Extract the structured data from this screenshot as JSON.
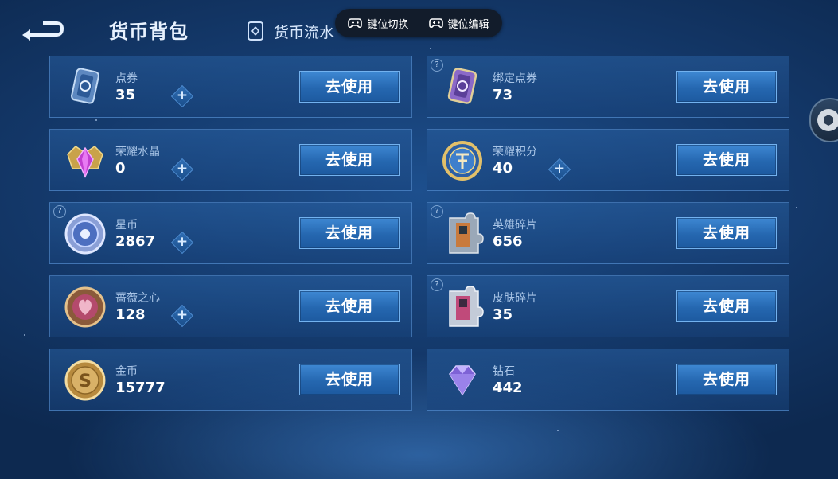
{
  "header": {
    "title": "货币背包",
    "flow_tab": "货币流水"
  },
  "overlay": {
    "switch_label": "键位切换",
    "edit_label": "键位编辑"
  },
  "items": [
    {
      "name": "点券",
      "amount": "35",
      "icon": "ticket-icon",
      "help": false,
      "plus": true,
      "button": "去使用"
    },
    {
      "name": "绑定点券",
      "amount": "73",
      "icon": "bound-ticket-icon",
      "help": true,
      "plus": false,
      "button": "去使用"
    },
    {
      "name": "荣耀水晶",
      "amount": "0",
      "icon": "glory-crystal-icon",
      "help": false,
      "plus": true,
      "button": "去使用"
    },
    {
      "name": "荣耀积分",
      "amount": "40",
      "icon": "glory-points-icon",
      "help": false,
      "plus": true,
      "button": "去使用"
    },
    {
      "name": "星币",
      "amount": "2867",
      "icon": "star-coin-icon",
      "help": true,
      "plus": true,
      "button": "去使用"
    },
    {
      "name": "英雄碎片",
      "amount": "656",
      "icon": "hero-fragment-icon",
      "help": true,
      "plus": false,
      "button": "去使用"
    },
    {
      "name": "蔷薇之心",
      "amount": "128",
      "icon": "rose-heart-icon",
      "help": false,
      "plus": true,
      "button": "去使用"
    },
    {
      "name": "皮肤碎片",
      "amount": "35",
      "icon": "skin-fragment-icon",
      "help": true,
      "plus": false,
      "button": "去使用"
    },
    {
      "name": "金币",
      "amount": "15777",
      "icon": "gold-coin-icon",
      "help": false,
      "plus": false,
      "button": "去使用"
    },
    {
      "name": "钻石",
      "amount": "442",
      "icon": "diamond-icon",
      "help": false,
      "plus": false,
      "button": "去使用"
    }
  ],
  "help_glyph": "?",
  "plus_glyph": "+",
  "colors": {
    "accent": "#3e88d3",
    "background": "#14396b",
    "card_border": "#5c96d7"
  }
}
